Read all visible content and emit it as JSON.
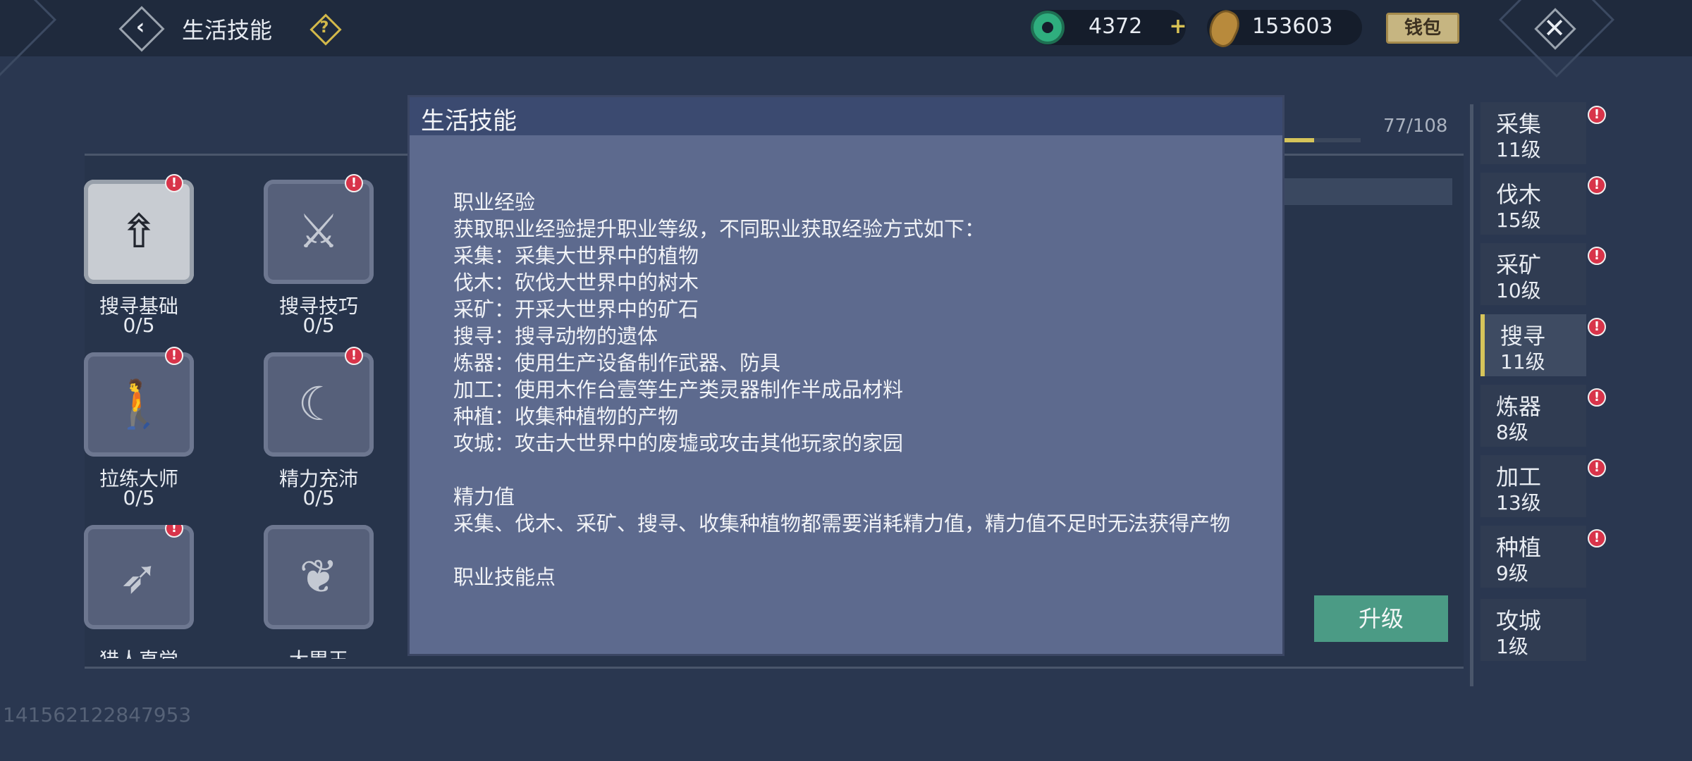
{
  "header": {
    "title": "生活技能",
    "currency1_value": "4372",
    "currency2_value": "153603",
    "wallet_label": "钱包"
  },
  "progress": {
    "text": "77/108",
    "fraction": 0.713
  },
  "skills": [
    {
      "name": "搜寻基础",
      "level": "0/5",
      "icon": "wing-arrows-icon"
    },
    {
      "name": "搜寻技巧",
      "level": "0/5",
      "icon": "claw-arrows-icon"
    },
    {
      "name": "拉练大师",
      "level": "0/5",
      "icon": "hiker-icon"
    },
    {
      "name": "精力充沛",
      "level": "0/5",
      "icon": "hand-moon-icon"
    },
    {
      "name": "猎人直觉",
      "level": "",
      "icon": "bow-arrow-icon"
    },
    {
      "name": "大胃王",
      "level": "",
      "icon": "stomach-icon"
    }
  ],
  "categories": [
    {
      "name": "采集",
      "level": "11级"
    },
    {
      "name": "伐木",
      "level": "15级"
    },
    {
      "name": "采矿",
      "level": "10级"
    },
    {
      "name": "搜寻",
      "level": "11级"
    },
    {
      "name": "炼器",
      "level": "8级"
    },
    {
      "name": "加工",
      "level": "13级"
    },
    {
      "name": "种植",
      "level": "9级"
    },
    {
      "name": "攻城",
      "level": "1级"
    }
  ],
  "upgrade_label": "升级",
  "uid": "141562122847953",
  "modal": {
    "title": "生活技能",
    "line1": "职业经验",
    "line2": "获取职业经验提升职业等级，不同职业获取经验方式如下：",
    "line3": "采集：采集大世界中的植物",
    "line4": "伐木：砍伐大世界中的树木",
    "line5": "采矿：开采大世界中的矿石",
    "line6": "搜寻：搜寻动物的遗体",
    "line7": "炼器：使用生产设备制作武器、防具",
    "line8": "加工：使用木作台壹等生产类灵器制作半成品材料",
    "line9": "种植：收集种植物的产物",
    "line10": "攻城：攻击大世界中的废墟或攻击其他玩家的家园",
    "line11": "精力值",
    "line12": "采集、伐木、采矿、搜寻、收集种植物都需要消耗精力值，精力值不足时无法获得产物",
    "line13": "职业技能点"
  },
  "colors": {
    "accent": "#d6c45a",
    "badge": "#d8344a",
    "upgrade": "#4b9b85"
  }
}
